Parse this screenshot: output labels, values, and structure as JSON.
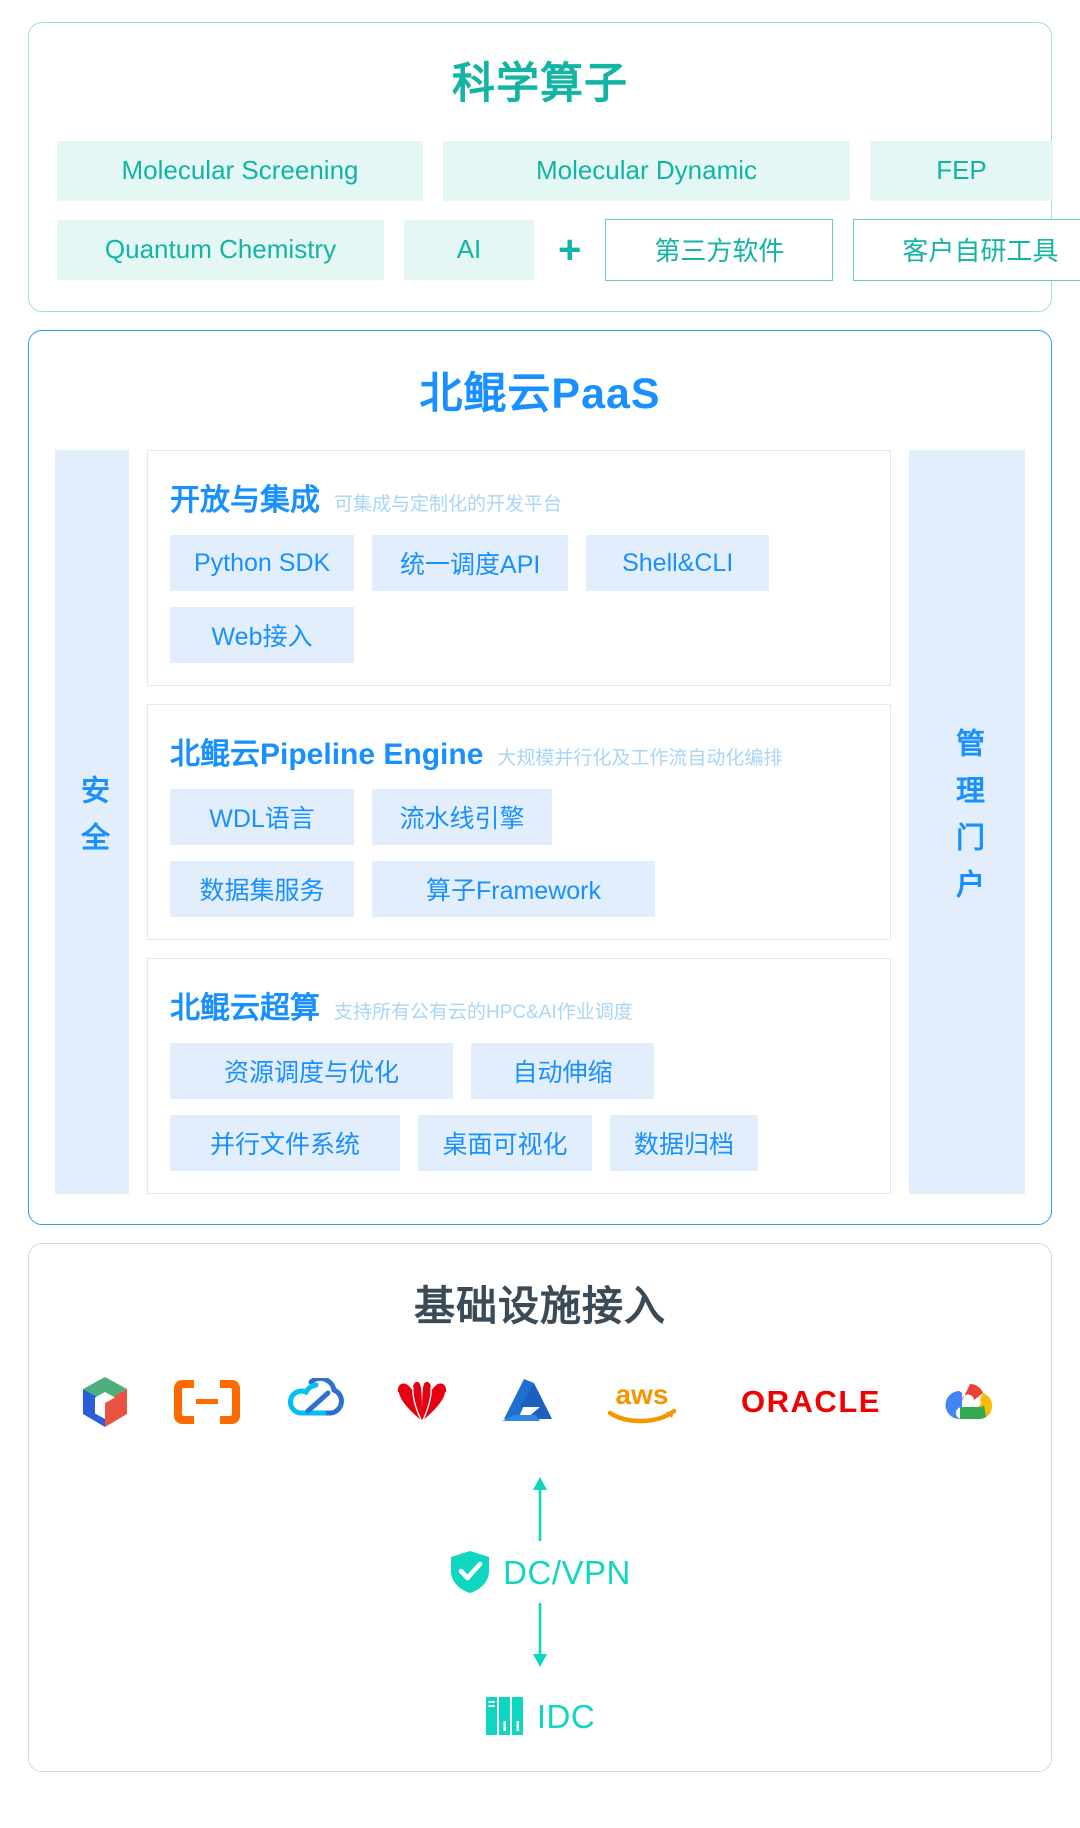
{
  "science": {
    "title": "科学算子",
    "row1": [
      {
        "label": "Molecular Screening",
        "style": "filled"
      },
      {
        "label": "Molecular Dynamic",
        "style": "filled"
      },
      {
        "label": "FEP",
        "style": "filled"
      }
    ],
    "row2": [
      {
        "label": "Quantum Chemistry",
        "style": "filled"
      },
      {
        "label": "AI",
        "style": "filled"
      }
    ],
    "plus": "+",
    "row2_outline": [
      {
        "label": "第三方软件",
        "style": "outline"
      },
      {
        "label": "客户自研工具",
        "style": "outline"
      }
    ]
  },
  "paas": {
    "title": "北鲲云PaaS",
    "left_column": "安全",
    "right_column": "管理门户",
    "panels": [
      {
        "title": "开放与集成",
        "subtitle": "可集成与定制化的开发平台",
        "rows": [
          [
            "Python SDK",
            "统一调度API",
            "Shell&CLI"
          ],
          [
            "Web接入"
          ]
        ]
      },
      {
        "title": "北鲲云Pipeline Engine",
        "subtitle": "大规模并行化及工作流自动化编排",
        "rows": [
          [
            "WDL语言",
            "流水线引擎"
          ],
          [
            "数据集服务",
            "算子Framework"
          ]
        ]
      },
      {
        "title": "北鲲云超算",
        "subtitle": "支持所有公有云的HPC&AI作业调度",
        "rows": [
          [
            "资源调度与优化",
            "自动伸缩"
          ],
          [
            "并行文件系统",
            "桌面可视化",
            "数据归档"
          ]
        ]
      }
    ]
  },
  "infra": {
    "title": "基础设施接入",
    "logos": [
      {
        "name": "volcano-engine-logo",
        "alt": "火山引擎"
      },
      {
        "name": "alibaba-cloud-logo",
        "alt": "阿里云"
      },
      {
        "name": "tencent-cloud-logo",
        "alt": "腾讯云"
      },
      {
        "name": "huawei-logo",
        "alt": "华为"
      },
      {
        "name": "microsoft-azure-logo",
        "alt": "Azure"
      },
      {
        "name": "aws-logo",
        "alt": "aws"
      },
      {
        "name": "oracle-logo",
        "alt": "ORACLE"
      },
      {
        "name": "google-cloud-logo",
        "alt": "Google Cloud"
      }
    ],
    "dc_vpn_label": "DC/VPN",
    "idc_label": "IDC"
  },
  "colors": {
    "teal": "#12b5a3",
    "teal_light_bg": "#e4f7f4",
    "blue": "#1890ff",
    "blue_light_bg": "#e3eefc",
    "blue_sub": "#a8d5f8",
    "panel_border": "#dcecfb",
    "infra_border": "#d6d9dd",
    "node_teal": "#0fd6c0",
    "title_dark": "#3b4a57"
  }
}
